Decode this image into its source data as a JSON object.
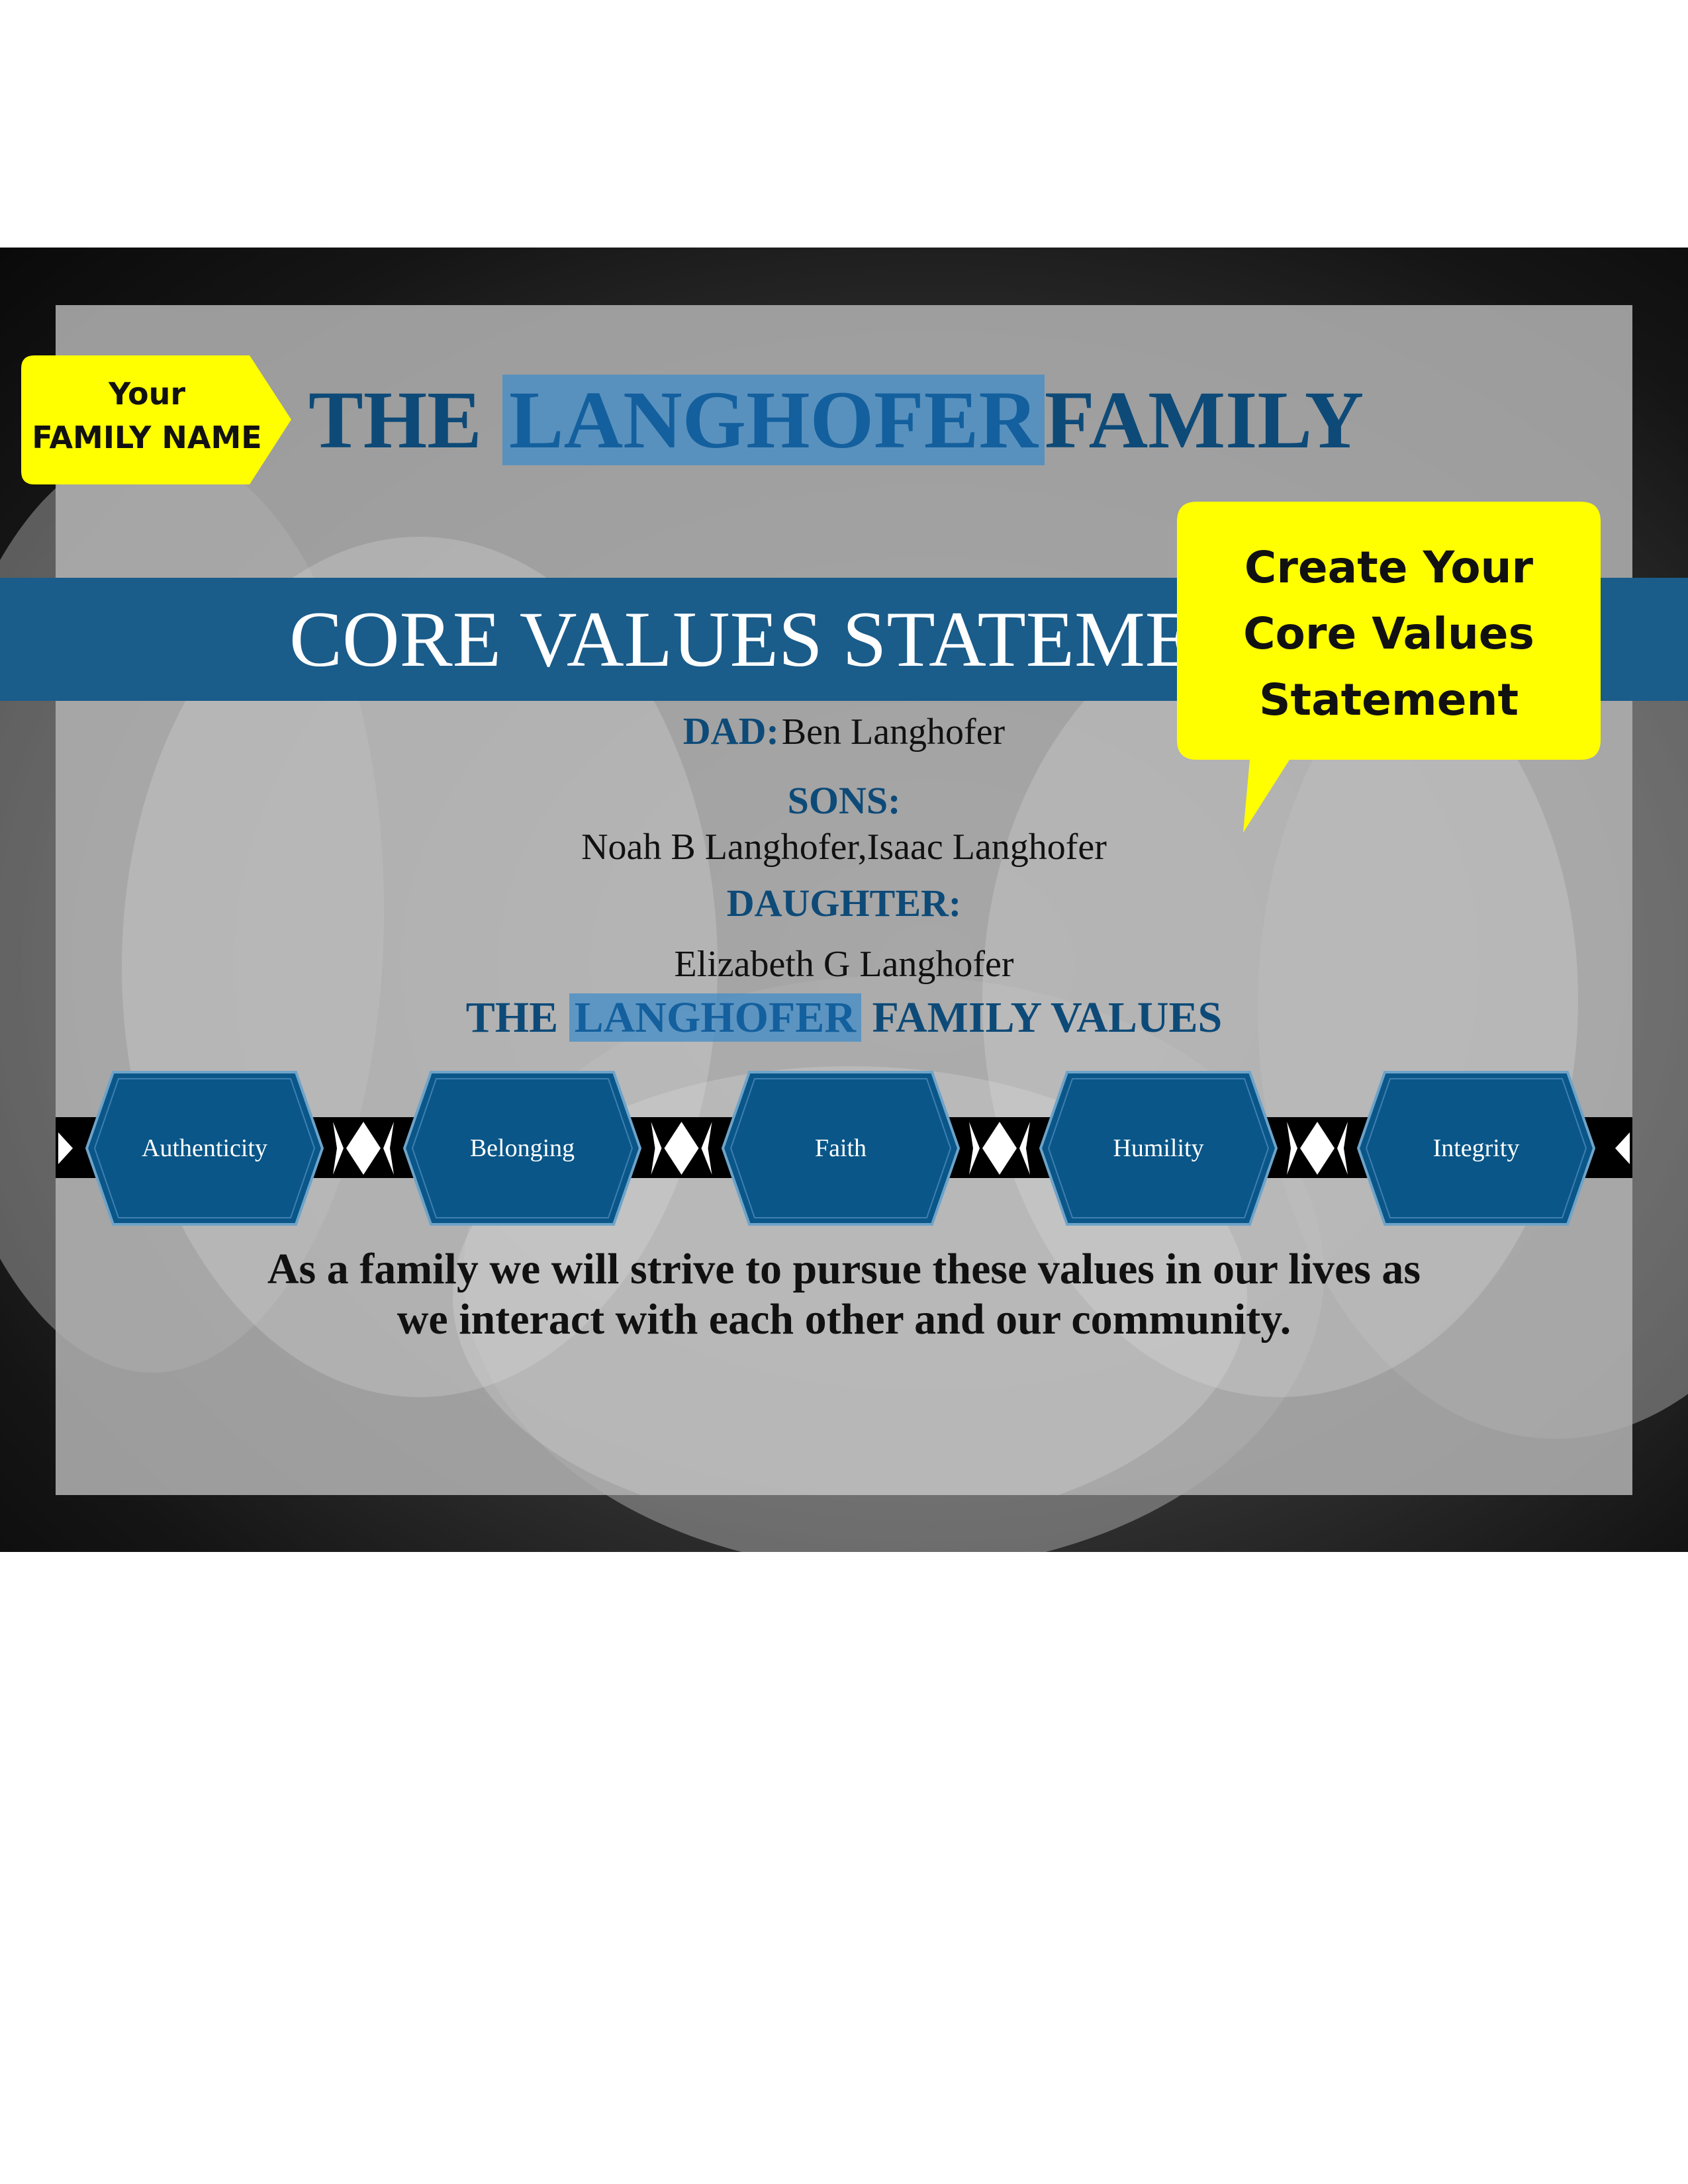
{
  "header": {
    "title_prefix": "THE",
    "family_name": "LANGHOFER",
    "title_suffix": "FAMILY"
  },
  "banner": {
    "text": "CORE VALUES STATEMENT"
  },
  "members": {
    "dad_label": "DAD:",
    "dad_name": "Ben Langhofer",
    "sons_label": "SONS:",
    "sons_names": "Noah B Langhofer,Isaac Langhofer",
    "daughter_label": "DAUGHTER:",
    "daughter_name": "Elizabeth G Langhofer"
  },
  "values_heading": {
    "prefix": "THE",
    "family_name": "LANGHOFER",
    "suffix": "FAMILY VALUES"
  },
  "values": [
    "Authenticity",
    "Belonging",
    "Faith",
    "Humility",
    "Integrity"
  ],
  "statement": {
    "line1": "As a family we will strive to pursue these values in our lives as",
    "line2": "we interact with each other and our community."
  },
  "tag": {
    "line1": "Your",
    "line2": "FAMILY NAME"
  },
  "callout": {
    "line1": "Create Your",
    "line2": "Core Values",
    "line3": "Statement"
  },
  "colors": {
    "navy": "#0d4a78",
    "banner": "#1a5c8a",
    "hex_fill": "#0a5688",
    "highlight": "#428cc8",
    "yellow": "#ffff00"
  }
}
